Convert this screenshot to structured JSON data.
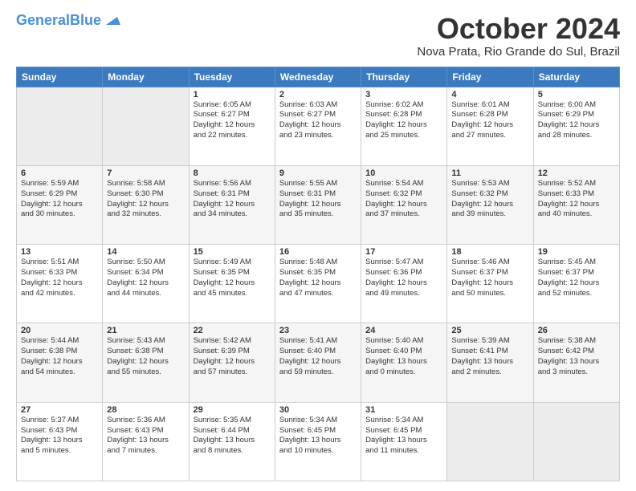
{
  "header": {
    "logo_line1": "General",
    "logo_line2": "Blue",
    "month": "October 2024",
    "location": "Nova Prata, Rio Grande do Sul, Brazil"
  },
  "weekdays": [
    "Sunday",
    "Monday",
    "Tuesday",
    "Wednesday",
    "Thursday",
    "Friday",
    "Saturday"
  ],
  "weeks": [
    [
      {
        "day": "",
        "text": ""
      },
      {
        "day": "",
        "text": ""
      },
      {
        "day": "1",
        "text": "Sunrise: 6:05 AM\nSunset: 6:27 PM\nDaylight: 12 hours\nand 22 minutes."
      },
      {
        "day": "2",
        "text": "Sunrise: 6:03 AM\nSunset: 6:27 PM\nDaylight: 12 hours\nand 23 minutes."
      },
      {
        "day": "3",
        "text": "Sunrise: 6:02 AM\nSunset: 6:28 PM\nDaylight: 12 hours\nand 25 minutes."
      },
      {
        "day": "4",
        "text": "Sunrise: 6:01 AM\nSunset: 6:28 PM\nDaylight: 12 hours\nand 27 minutes."
      },
      {
        "day": "5",
        "text": "Sunrise: 6:00 AM\nSunset: 6:29 PM\nDaylight: 12 hours\nand 28 minutes."
      }
    ],
    [
      {
        "day": "6",
        "text": "Sunrise: 5:59 AM\nSunset: 6:29 PM\nDaylight: 12 hours\nand 30 minutes."
      },
      {
        "day": "7",
        "text": "Sunrise: 5:58 AM\nSunset: 6:30 PM\nDaylight: 12 hours\nand 32 minutes."
      },
      {
        "day": "8",
        "text": "Sunrise: 5:56 AM\nSunset: 6:31 PM\nDaylight: 12 hours\nand 34 minutes."
      },
      {
        "day": "9",
        "text": "Sunrise: 5:55 AM\nSunset: 6:31 PM\nDaylight: 12 hours\nand 35 minutes."
      },
      {
        "day": "10",
        "text": "Sunrise: 5:54 AM\nSunset: 6:32 PM\nDaylight: 12 hours\nand 37 minutes."
      },
      {
        "day": "11",
        "text": "Sunrise: 5:53 AM\nSunset: 6:32 PM\nDaylight: 12 hours\nand 39 minutes."
      },
      {
        "day": "12",
        "text": "Sunrise: 5:52 AM\nSunset: 6:33 PM\nDaylight: 12 hours\nand 40 minutes."
      }
    ],
    [
      {
        "day": "13",
        "text": "Sunrise: 5:51 AM\nSunset: 6:33 PM\nDaylight: 12 hours\nand 42 minutes."
      },
      {
        "day": "14",
        "text": "Sunrise: 5:50 AM\nSunset: 6:34 PM\nDaylight: 12 hours\nand 44 minutes."
      },
      {
        "day": "15",
        "text": "Sunrise: 5:49 AM\nSunset: 6:35 PM\nDaylight: 12 hours\nand 45 minutes."
      },
      {
        "day": "16",
        "text": "Sunrise: 5:48 AM\nSunset: 6:35 PM\nDaylight: 12 hours\nand 47 minutes."
      },
      {
        "day": "17",
        "text": "Sunrise: 5:47 AM\nSunset: 6:36 PM\nDaylight: 12 hours\nand 49 minutes."
      },
      {
        "day": "18",
        "text": "Sunrise: 5:46 AM\nSunset: 6:37 PM\nDaylight: 12 hours\nand 50 minutes."
      },
      {
        "day": "19",
        "text": "Sunrise: 5:45 AM\nSunset: 6:37 PM\nDaylight: 12 hours\nand 52 minutes."
      }
    ],
    [
      {
        "day": "20",
        "text": "Sunrise: 5:44 AM\nSunset: 6:38 PM\nDaylight: 12 hours\nand 54 minutes."
      },
      {
        "day": "21",
        "text": "Sunrise: 5:43 AM\nSunset: 6:38 PM\nDaylight: 12 hours\nand 55 minutes."
      },
      {
        "day": "22",
        "text": "Sunrise: 5:42 AM\nSunset: 6:39 PM\nDaylight: 12 hours\nand 57 minutes."
      },
      {
        "day": "23",
        "text": "Sunrise: 5:41 AM\nSunset: 6:40 PM\nDaylight: 12 hours\nand 59 minutes."
      },
      {
        "day": "24",
        "text": "Sunrise: 5:40 AM\nSunset: 6:40 PM\nDaylight: 13 hours\nand 0 minutes."
      },
      {
        "day": "25",
        "text": "Sunrise: 5:39 AM\nSunset: 6:41 PM\nDaylight: 13 hours\nand 2 minutes."
      },
      {
        "day": "26",
        "text": "Sunrise: 5:38 AM\nSunset: 6:42 PM\nDaylight: 13 hours\nand 3 minutes."
      }
    ],
    [
      {
        "day": "27",
        "text": "Sunrise: 5:37 AM\nSunset: 6:43 PM\nDaylight: 13 hours\nand 5 minutes."
      },
      {
        "day": "28",
        "text": "Sunrise: 5:36 AM\nSunset: 6:43 PM\nDaylight: 13 hours\nand 7 minutes."
      },
      {
        "day": "29",
        "text": "Sunrise: 5:35 AM\nSunset: 6:44 PM\nDaylight: 13 hours\nand 8 minutes."
      },
      {
        "day": "30",
        "text": "Sunrise: 5:34 AM\nSunset: 6:45 PM\nDaylight: 13 hours\nand 10 minutes."
      },
      {
        "day": "31",
        "text": "Sunrise: 5:34 AM\nSunset: 6:45 PM\nDaylight: 13 hours\nand 11 minutes."
      },
      {
        "day": "",
        "text": ""
      },
      {
        "day": "",
        "text": ""
      }
    ]
  ]
}
